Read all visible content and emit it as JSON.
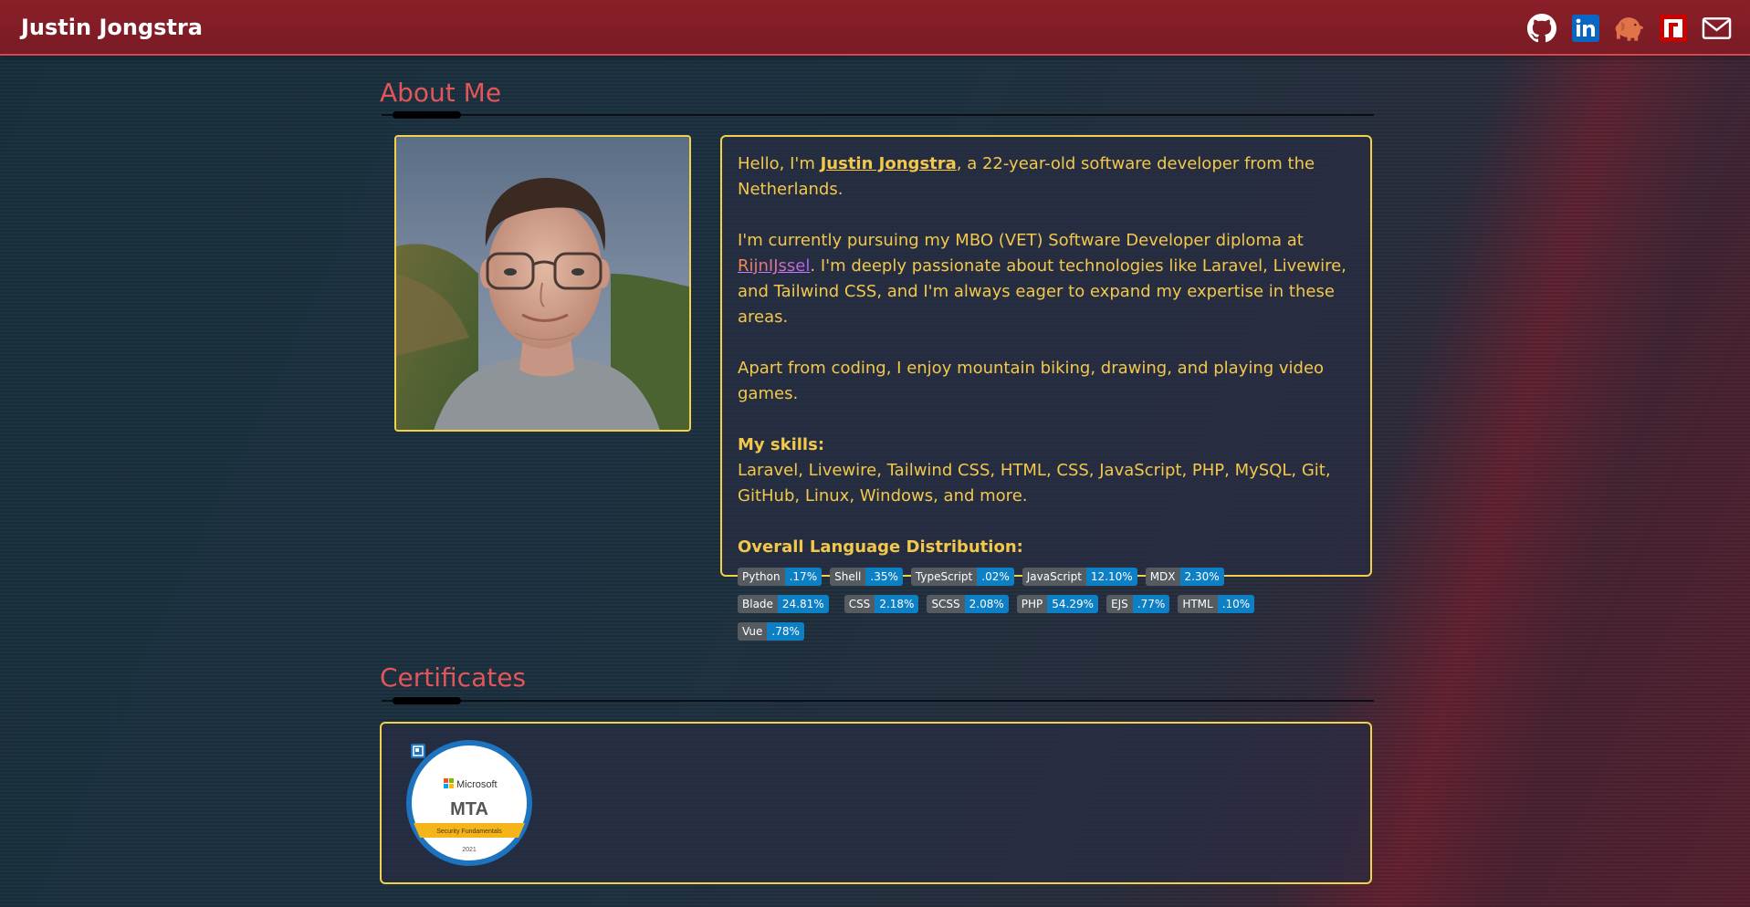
{
  "header": {
    "brand": "Justin Jongstra",
    "icons": [
      "github-icon",
      "linkedin-icon",
      "laravel-elephant-icon",
      "npm-icon",
      "mail-icon"
    ]
  },
  "about": {
    "title": "About Me",
    "intro_pre": "Hello, I'm ",
    "name": "Justin Jongstra",
    "intro_post": ", a 22-year-old software developer from the Netherlands.",
    "study_pre": "I'm currently pursuing my MBO (VET) Software Developer diploma at ",
    "school": "RijnIJssel",
    "study_post": ". I'm deeply passionate about technologies like Laravel, Livewire, and Tailwind CSS, and I'm always eager to expand my expertise in these areas.",
    "hobbies": "Apart from coding, I enjoy mountain biking, drawing, and playing video games.",
    "skills_heading": "My skills:",
    "skills": "Laravel, Livewire, Tailwind CSS, HTML, CSS, JavaScript, PHP, MySQL, Git, GitHub, Linux, Windows, and more.",
    "lang_heading": "Overall Language Distribution:",
    "languages": [
      {
        "name": "Python",
        "pct": ".17%"
      },
      {
        "name": "Shell",
        "pct": ".35%"
      },
      {
        "name": "TypeScript",
        "pct": ".02%"
      },
      {
        "name": "JavaScript",
        "pct": "12.10%"
      },
      {
        "name": "MDX",
        "pct": "2.30%"
      },
      {
        "name": "Blade",
        "pct": "24.81%"
      },
      {
        "name": "CSS",
        "pct": "2.18%"
      },
      {
        "name": "SCSS",
        "pct": "2.08%"
      },
      {
        "name": "PHP",
        "pct": "54.29%"
      },
      {
        "name": "EJS",
        "pct": ".77%"
      },
      {
        "name": "HTML",
        "pct": ".10%"
      },
      {
        "name": "Vue",
        "pct": ".78%"
      }
    ]
  },
  "certificates": {
    "title": "Certificates",
    "badge": {
      "vendor": "Microsoft",
      "code": "MTA",
      "subject": "Security Fundamentals",
      "year": "2021"
    }
  },
  "colors": {
    "accent_red": "#e2555a",
    "header_red": "#7a1b25",
    "card_border": "#f1d24a",
    "text_yellow": "#f3c84a",
    "badge_label": "#555b61",
    "badge_value": "#0d7fc5"
  }
}
